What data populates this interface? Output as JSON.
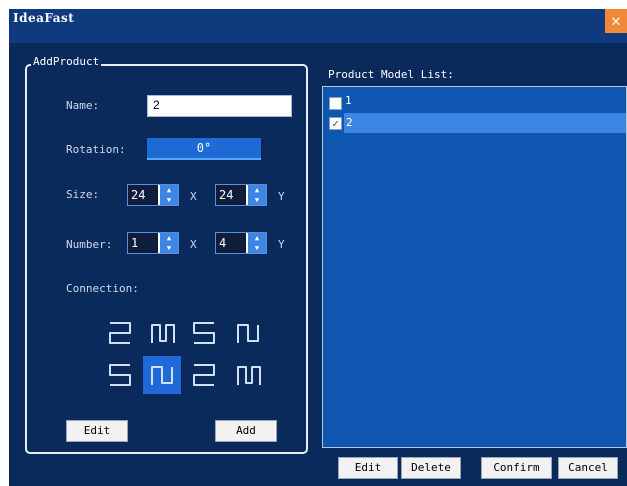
{
  "window": {
    "title": "IdeaFast",
    "close_icon": "close-icon"
  },
  "add_product": {
    "legend": "AddProduct",
    "name_label": "Name:",
    "name_value": "2",
    "rotation_label": "Rotation:",
    "rotation_value": "0°",
    "size_label": "Size:",
    "size_x": "24",
    "size_y": "24",
    "number_label": "Number:",
    "number_x": "1",
    "number_y": "4",
    "x_label": "X",
    "y_label": "Y",
    "connection_label": "Connection:",
    "connection_icons": [
      "zigzag-icon",
      "snake-up-icon",
      "s-path-icon",
      "meander-icon",
      "s-path-icon",
      "meander-icon",
      "zigzag-icon",
      "snake-up-icon"
    ],
    "connection_selected_index": 5,
    "edit_button": "Edit",
    "add_button": "Add"
  },
  "product_list": {
    "label": "Product Model List:",
    "items": [
      {
        "label": "1",
        "checked": false,
        "selected": false
      },
      {
        "label": "2",
        "checked": true,
        "selected": true
      }
    ]
  },
  "actions": {
    "edit": "Edit",
    "delete": "Delete",
    "confirm": "Confirm",
    "cancel": "Cancel"
  },
  "colors": {
    "window_bg": "#0b2a5c",
    "accent": "#1e6bd6",
    "list_bg": "#0f56b0",
    "selection": "#3d86e6"
  }
}
